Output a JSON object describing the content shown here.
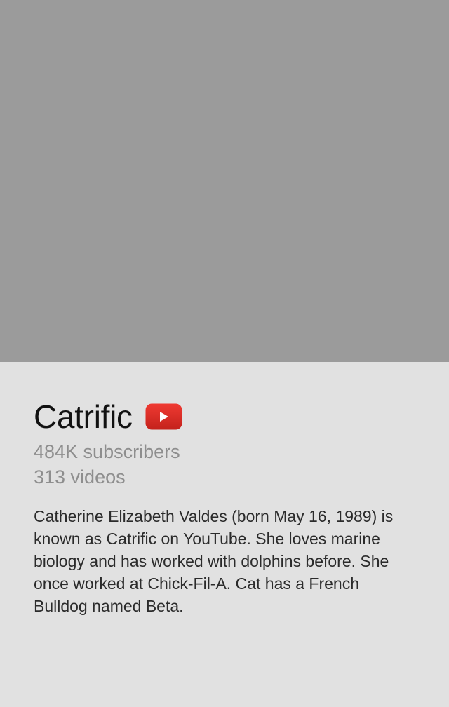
{
  "channel": {
    "name": "Catrific",
    "subscribers": "484K subscribers",
    "videos": "313 videos",
    "bio": "Catherine Elizabeth Valdes (born May 16, 1989) is known as Catrific on YouTube. She loves marine biology and has worked with dolphins before. She once worked at Chick-Fil-A. Cat has a French Bulldog named Beta."
  },
  "icons": {
    "platform": "youtube-play-icon"
  },
  "colors": {
    "cover_placeholder": "#9b9b9b",
    "background": "#e1e1e1",
    "youtube_red": "#e52d27",
    "title_text": "#111111",
    "meta_text": "#8e8e8e",
    "body_text": "#2b2b2b"
  }
}
